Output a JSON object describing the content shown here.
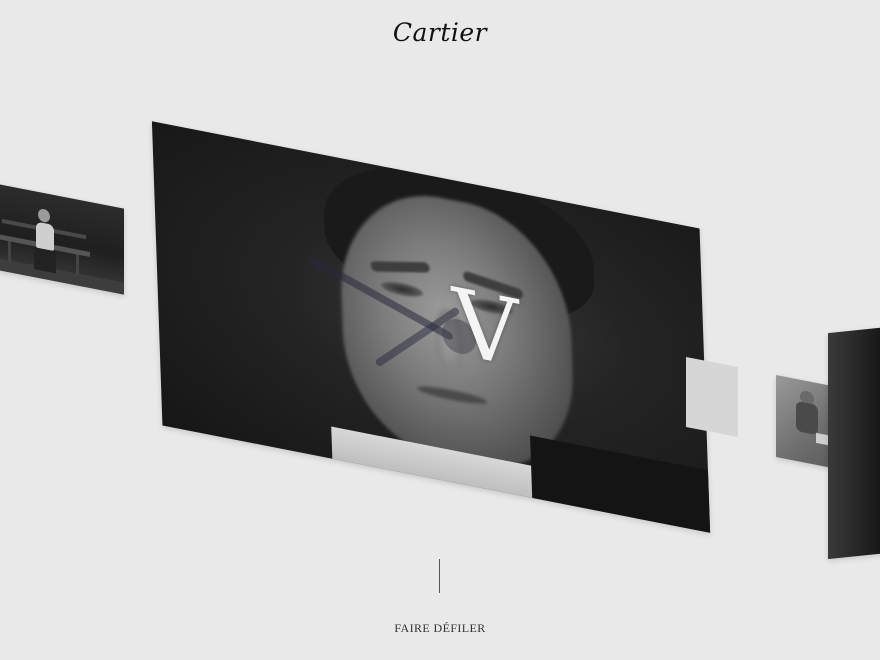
{
  "header": {
    "logo_text": "Cartier"
  },
  "carousel": {
    "panels": [
      {
        "id": "left",
        "subject": "man-on-bench"
      },
      {
        "id": "main",
        "subject": "portrait-close-up",
        "overlay_numeral": "V"
      },
      {
        "id": "ghost",
        "subject": "blank"
      },
      {
        "id": "right",
        "subject": "man-at-table"
      },
      {
        "id": "edge",
        "subject": "dark-sliver"
      }
    ]
  },
  "footer": {
    "scroll_hint": "FAIRE DÉFILER"
  },
  "colors": {
    "background": "#e9e9e9",
    "text": "#111111"
  }
}
